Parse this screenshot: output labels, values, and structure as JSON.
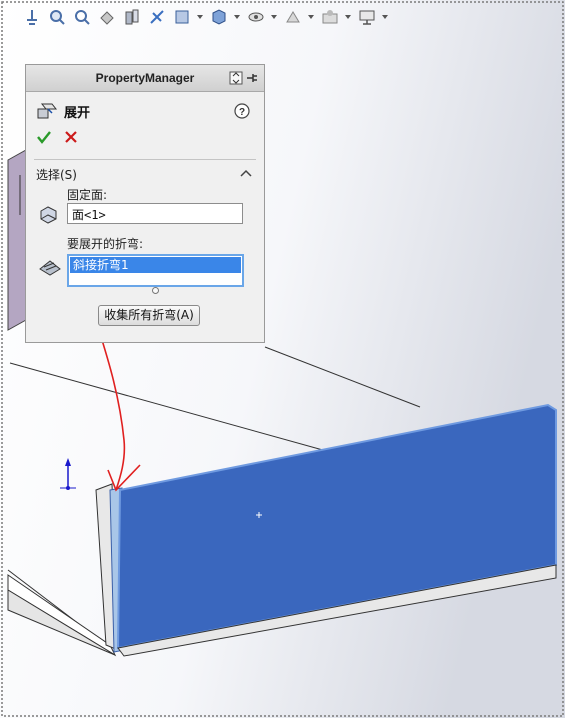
{
  "toolbar": {
    "icons": [
      "normal-to-icon",
      "zoom-to-fit-icon",
      "zoom-area-icon",
      "previous-view-icon",
      "section-view-icon",
      "dynamic-annotation-icon",
      "view-orientation-icon",
      "display-style-icon",
      "hide-show-icon",
      "edit-appearance-icon",
      "apply-scene-icon",
      "view-settings-icon"
    ]
  },
  "property_manager": {
    "title": "PropertyManager",
    "feature_title": "展开",
    "section": {
      "title": "选择(S)"
    },
    "fixed_face": {
      "label": "固定面:",
      "value": "面<1>"
    },
    "bends": {
      "label": "要展开的折弯:",
      "items": [
        "斜接折弯1"
      ]
    },
    "collect_button": "收集所有折弯(A)"
  },
  "colors": {
    "selected_face": "#3a67be",
    "annotation_red": "#e02020",
    "list_highlight": "#3a86e8",
    "panel_bg": "#f0f0f0"
  }
}
